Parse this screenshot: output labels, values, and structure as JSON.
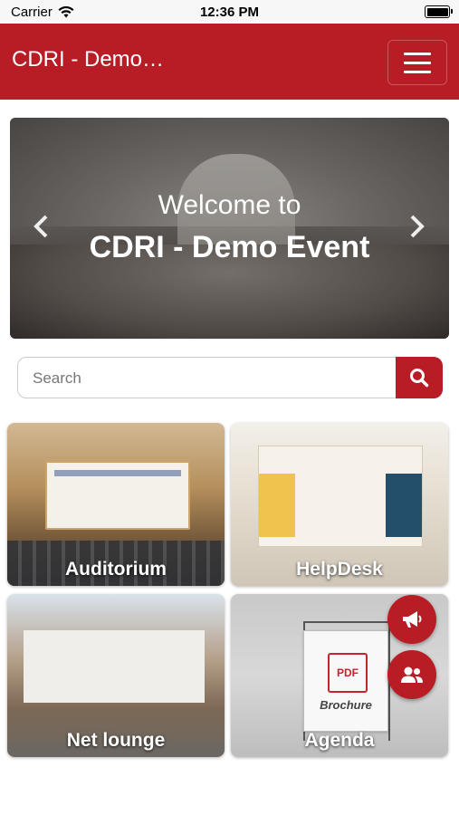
{
  "status_bar": {
    "carrier": "Carrier",
    "time": "12:36 PM"
  },
  "navbar": {
    "title": "CDRI - Demo…"
  },
  "carousel": {
    "welcome": "Welcome to",
    "event_name": "CDRI - Demo Event"
  },
  "search": {
    "placeholder": "Search"
  },
  "tiles": [
    {
      "label": "Auditorium"
    },
    {
      "label": "HelpDesk"
    },
    {
      "label": "Net lounge"
    },
    {
      "label": "Agenda"
    }
  ],
  "tile_art": {
    "pdf": "PDF",
    "brochure": "Brochure"
  },
  "colors": {
    "brand": "#b81c25"
  }
}
